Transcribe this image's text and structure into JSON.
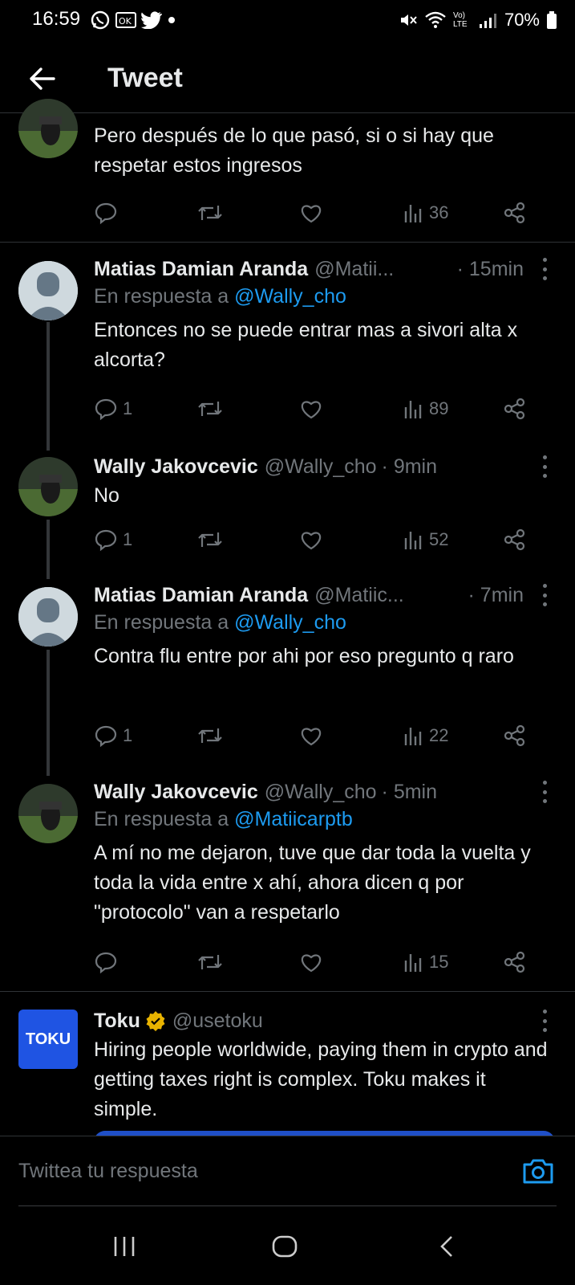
{
  "status": {
    "time": "16:59",
    "battery": "70%",
    "network": "Vo) LTE"
  },
  "header": {
    "title": "Tweet"
  },
  "tweets": [
    {
      "text": "Pero después de lo que pasó, si o si hay que respetar estos ingresos",
      "reply": "",
      "retweet": "",
      "like": "",
      "views": "36"
    },
    {
      "name": "Matias Damian Aranda",
      "handle": "@Matii...",
      "time": "· 15min",
      "reply_prefix": "En respuesta a",
      "reply_mention": "@Wally_cho",
      "text": "Entonces no se puede entrar mas a sivori alta x alcorta?",
      "reply": "1",
      "views": "89"
    },
    {
      "name": "Wally Jakovcevic",
      "handle": "@Wally_cho",
      "time": "· 9min",
      "text": "No",
      "reply": "1",
      "views": "52"
    },
    {
      "name": "Matias Damian Aranda",
      "handle": "@Matiic...",
      "time": "· 7min",
      "reply_prefix": "En respuesta a",
      "reply_mention": "@Wally_cho",
      "text": "Contra flu entre por ahi por eso pregunto q raro",
      "reply": "1",
      "views": "22"
    },
    {
      "name": "Wally Jakovcevic",
      "handle": "@Wally_cho",
      "time": "· 5min",
      "reply_prefix": "En respuesta a",
      "reply_mention": "@Matiicarptb",
      "text": "A mí no me dejaron, tuve que dar toda la vuelta y toda la vida entre x ahí, ahora dicen q por \"protocolo\" van a respetarlo",
      "reply": "",
      "views": "15"
    },
    {
      "name": "Toku",
      "handle": "@usetoku",
      "logo_text": "TOKU",
      "text": "Hiring people worldwide, paying them in crypto and getting taxes right is complex. Toku makes it simple."
    }
  ],
  "composer": {
    "placeholder": "Twittea tu respuesta"
  },
  "colors": {
    "link": "#1d9bf0",
    "muted": "#71767b",
    "text": "#e7e9ea",
    "toku_blue": "#1f54e3"
  }
}
